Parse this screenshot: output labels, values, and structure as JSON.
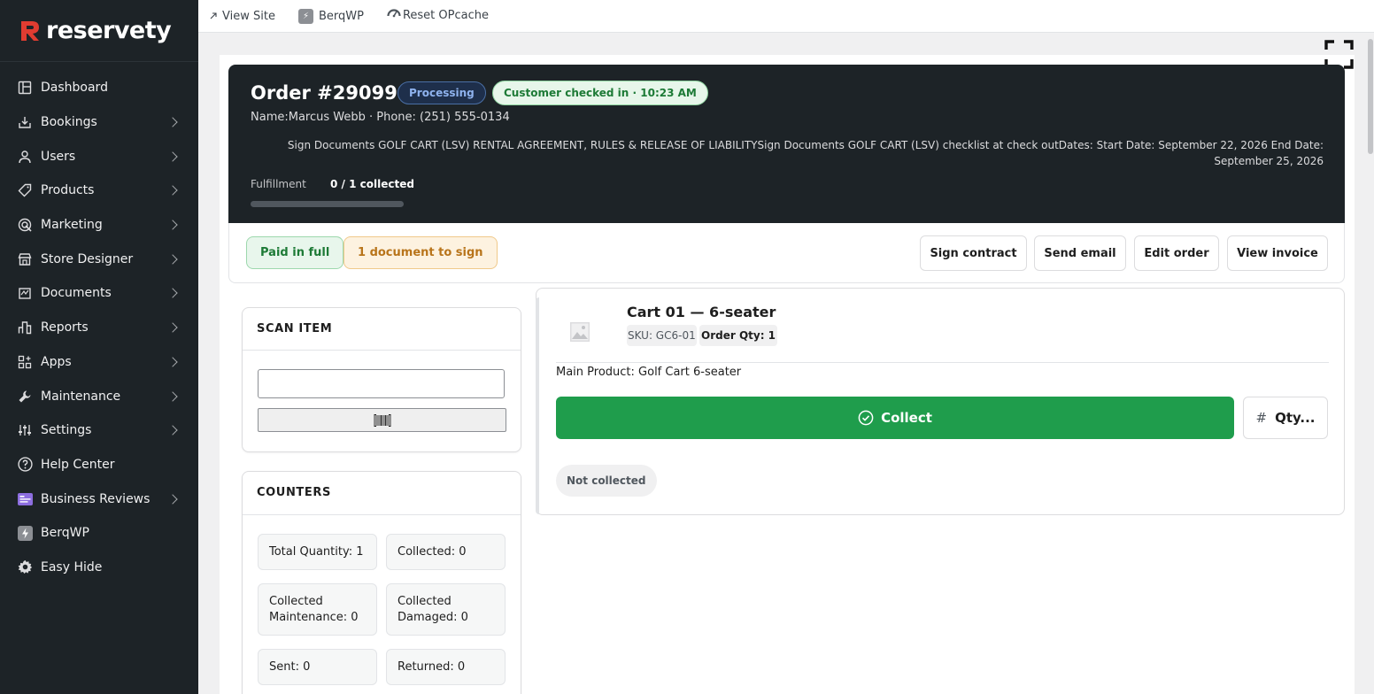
{
  "brand": {
    "name": "reservety",
    "accent": "#e03c31"
  },
  "sidebar": {
    "items": [
      {
        "label": "Dashboard",
        "icon": "dashboard-icon",
        "chevron": false
      },
      {
        "label": "Bookings",
        "icon": "bookings-icon",
        "chevron": true
      },
      {
        "label": "Users",
        "icon": "user-icon",
        "chevron": true
      },
      {
        "label": "Products",
        "icon": "tag-icon",
        "chevron": true
      },
      {
        "label": "Marketing",
        "icon": "marketing-icon",
        "chevron": true
      },
      {
        "label": "Store Designer",
        "icon": "store-icon",
        "chevron": true
      },
      {
        "label": "Documents",
        "icon": "documents-icon",
        "chevron": true
      },
      {
        "label": "Reports",
        "icon": "reports-icon",
        "chevron": true
      },
      {
        "label": "Apps",
        "icon": "apps-icon",
        "chevron": true
      },
      {
        "label": "Maintenance",
        "icon": "wrench-icon",
        "chevron": true
      },
      {
        "label": "Settings",
        "icon": "sliders-icon",
        "chevron": true
      },
      {
        "label": "Help Center",
        "icon": "help-icon",
        "chevron": false
      },
      {
        "label": "Business Reviews",
        "icon": "reviews-icon",
        "chevron": true
      },
      {
        "label": "BerqWP",
        "icon": "berqwp-icon",
        "chevron": false
      },
      {
        "label": "Easy Hide",
        "icon": "gear-icon",
        "chevron": false
      }
    ]
  },
  "topbar": {
    "view_site": "View Site",
    "berqwp": "BerqWP",
    "reset_opcache": "Reset OPcache"
  },
  "order": {
    "title": "Order #29099",
    "status": "Processing",
    "checkin": "Customer checked in · 10:23 AM",
    "customer_line": "Name:Marcus Webb · Phone: (251) 555-0134",
    "documents_line": "Sign Documents GOLF CART (LSV) RENTAL AGREEMENT, RULES & RELEASE OF LIABILITYSign Documents GOLF CART (LSV) checklist at check outDates:  Start Date: September 22, 2026  End Date: September 25, 2026",
    "fulfillment_label": "Fulfillment",
    "fulfillment_value": "0 / 1 collected",
    "fulfillment_progress": 0
  },
  "actions": {
    "paid": "Paid in full",
    "documents": "1 document to sign",
    "sign_contract": "Sign contract",
    "send_email": "Send email",
    "edit_order": "Edit order",
    "view_invoice": "View invoice"
  },
  "scan": {
    "title": "SCAN ITEM",
    "input_value": "",
    "button_icon": "barcode-icon"
  },
  "counters": {
    "title": "COUNTERS",
    "items": [
      "Total Quantity: 1",
      "Collected: 0",
      "Collected Maintenance: 0",
      "Collected Damaged: 0",
      "Sent: 0",
      "Returned: 0"
    ]
  },
  "product": {
    "name": "Cart 01 — 6-seater",
    "sku": "SKU: GC6-01",
    "order_qty": "Order Qty: 1",
    "main_product": "Main Product: Golf Cart 6-seater",
    "collect_label": "Collect",
    "qty_label": "Qty...",
    "qty_symbol": "#",
    "status": "Not collected"
  },
  "colors": {
    "sidebar_bg": "#1d2327",
    "collect_green": "#1f9d4c",
    "processing_blue": "#8fb3ee",
    "checked_green": "#1d7a36"
  }
}
